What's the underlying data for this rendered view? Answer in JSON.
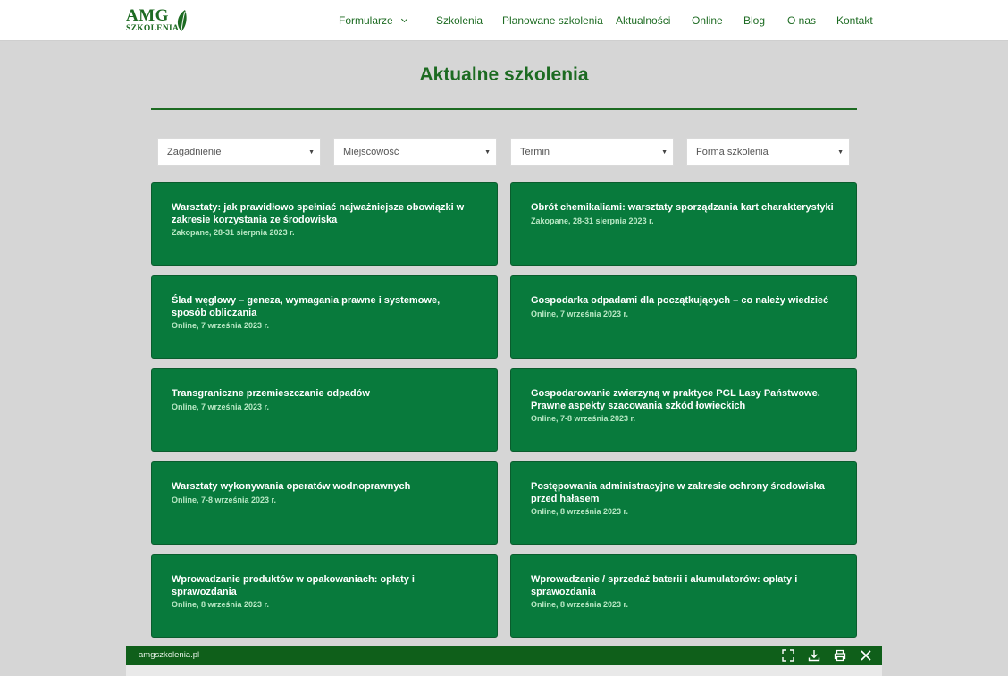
{
  "header": {
    "logo_main": "AMG",
    "logo_sub": "SZKOLENIA",
    "nav": [
      {
        "label": "Formularze"
      },
      {
        "label": "Szkolenia"
      },
      {
        "label": "Planowane szkolenia"
      },
      {
        "label": "Aktualności"
      },
      {
        "label": "Online"
      },
      {
        "label": "Blog"
      },
      {
        "label": "O nas"
      },
      {
        "label": "Kontakt"
      }
    ]
  },
  "main": {
    "title": "Aktualne szkolenia",
    "filters": [
      {
        "label": "Zagadnienie"
      },
      {
        "label": "Miejscowość"
      },
      {
        "label": "Termin"
      },
      {
        "label": "Forma szkolenia"
      }
    ],
    "courses": [
      {
        "title": "Warsztaty: jak prawidłowo spełniać najważniejsze obowiązki w zakresie korzystania ze środowiska",
        "meta": "Zakopane, 28-31 sierpnia 2023 r."
      },
      {
        "title": "Obrót chemikaliami: warsztaty sporządzania kart charakterystyki",
        "meta": "Zakopane, 28-31 sierpnia 2023 r."
      },
      {
        "title": "Ślad węglowy – geneza, wymagania prawne i systemowe, sposób obliczania",
        "meta": "Online, 7 września 2023 r."
      },
      {
        "title": "Gospodarka odpadami dla początkujących – co należy wiedzieć",
        "meta": "Online, 7 września 2023 r."
      },
      {
        "title": "Transgraniczne przemieszczanie odpadów",
        "meta": "Online, 7 września 2023 r."
      },
      {
        "title": "Gospodarowanie zwierzyną w praktyce PGL Lasy Państwowe. Prawne aspekty szacowania szkód łowieckich",
        "meta": "Online, 7-8 września 2023 r."
      },
      {
        "title": "Warsztaty wykonywania operatów wodnoprawnych",
        "meta": "Online, 7-8 września 2023 r."
      },
      {
        "title": "Postępowania administracyjne w zakresie ochrony środowiska przed hałasem",
        "meta": "Online, 8 września 2023 r."
      },
      {
        "title": "Wprowadzanie produktów w opakowaniach: opłaty i sprawozdania",
        "meta": "Online, 8 września 2023 r."
      },
      {
        "title": "Wprowadzanie / sprzedaż baterii i akumulatorów: opłaty i sprawozdania",
        "meta": "Online, 8 września 2023 r."
      }
    ]
  },
  "viewer": {
    "url": "amgszkolenia.pl",
    "buttons": [
      {
        "icon": "fullscreen-icon"
      },
      {
        "icon": "download-icon"
      },
      {
        "icon": "print-icon"
      },
      {
        "icon": "close-icon"
      }
    ]
  },
  "colors": {
    "brand_green": "#1d6b22",
    "card_green": "#087a3c",
    "viewer_bar": "#0f5f1a",
    "page_bg": "#d6d6d6"
  }
}
